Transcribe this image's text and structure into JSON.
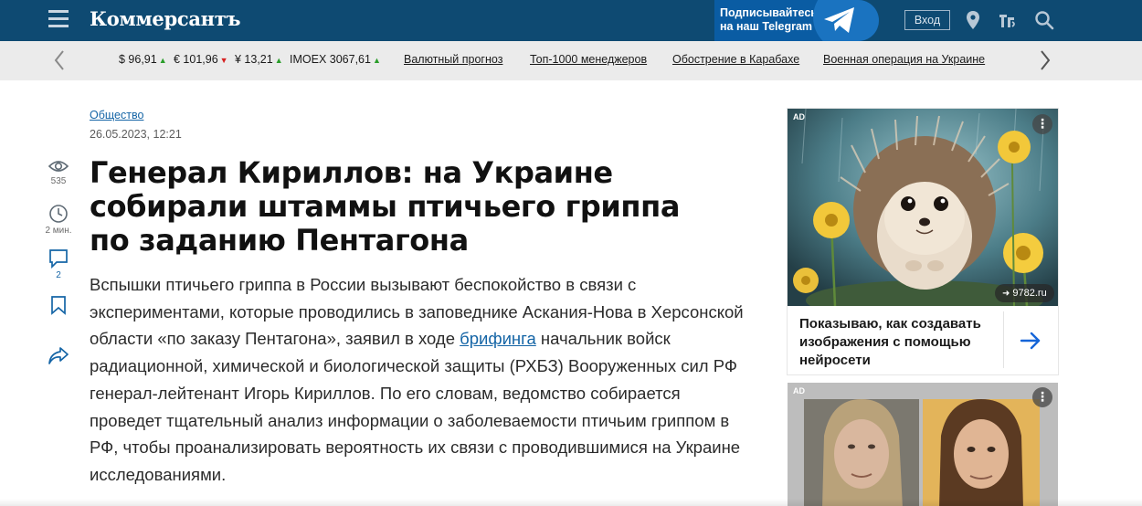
{
  "header": {
    "logo": "Коммерсантъ",
    "telegram_promo_line1": "Подписывайтесь",
    "telegram_promo_line2": "на наш Telegram",
    "login_label": "Вход",
    "icons": [
      "menu-icon",
      "telegram-icon",
      "location-icon",
      "radio-icon",
      "search-icon"
    ],
    "colors": {
      "bar": "#0e4a72",
      "promo": "#0a5ca3"
    }
  },
  "ticker": {
    "quotes": [
      {
        "label": "$ 96,91",
        "trend": "up"
      },
      {
        "label": "€ 101,96",
        "trend": "down"
      },
      {
        "label": "¥ 13,21",
        "trend": "up"
      },
      {
        "label": "IMOEX 3067,61",
        "trend": "up"
      }
    ],
    "links": [
      "Валютный прогноз",
      "Топ-1000 менеджеров",
      "Обострение в Карабахе",
      "Военная операция на Украине"
    ],
    "colors": {
      "up": "#2a9d2a",
      "down": "#d62020"
    }
  },
  "rail": {
    "views": "535",
    "read_time": "2 мин.",
    "comments": "2"
  },
  "article": {
    "rubric": "Общество",
    "date": "26.05.2023, 12:21",
    "title": "Генерал Кириллов: на Украине собирали штаммы птичьего гриппа по заданию Пентагона",
    "lead_before_link": "Вспышки птичьего гриппа в России вызывают беспокойство в связи с экспериментами, которые проводились в заповеднике Аскания-Нова в Херсонской области «по заказу Пентагона», заявил в ходе ",
    "lead_link": "брифинга",
    "lead_after_link": " начальник войск радиационной, химической и биологической защиты (РХБЗ) Вооруженных сил РФ генерал-лейтенант Игорь Кириллов. По его словам, ведомство собирается проведет тщательный анализ информации о заболеваемости птичьим гриппом в РФ, чтобы проанализировать вероятность их связи с проводившимися на Украине исследованиями."
  },
  "ads": [
    {
      "badge": "AD",
      "domain": "9782.ru",
      "text": "Показываю, как создавать изображения с помощью нейросети",
      "more": "⋮"
    },
    {
      "badge": "AD",
      "more": "⋮"
    }
  ]
}
